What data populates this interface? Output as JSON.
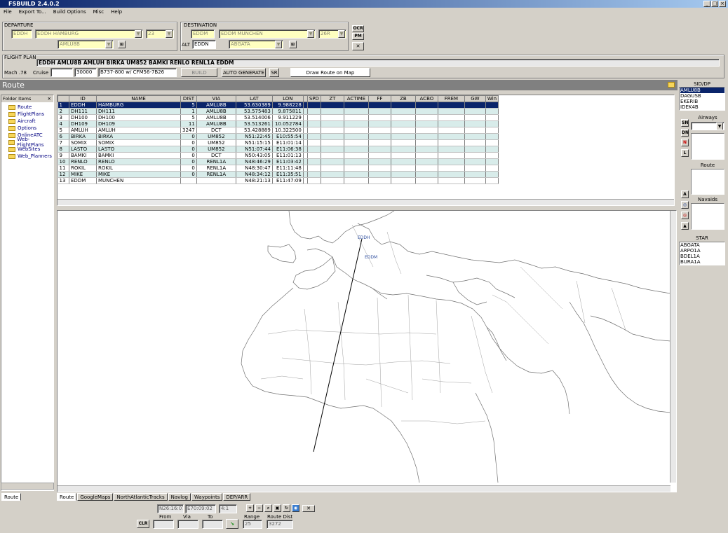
{
  "window": {
    "title": "FSBUILD 2.4.0.2"
  },
  "menu": [
    "File",
    "Export To...",
    "Build Options",
    "Misc",
    "Help"
  ],
  "departure": {
    "group_label": "DEPARTURE",
    "icao": "EDDH",
    "airport": "EDDH HAMBURG",
    "runway": "23",
    "sid": "AMLU8B"
  },
  "destination": {
    "group_label": "DESTINATION",
    "icao": "EDDM",
    "airport": "EDDM MUNCHEN",
    "runway": "26R",
    "alt_label": "ALT",
    "alt_icao": "EDDN",
    "star": "ABGATA"
  },
  "side_buttons": {
    "ocr": "OCR",
    "pm": "PM"
  },
  "flight_plan": {
    "group_label": "FLIGHT PLAN",
    "route": "EDDH AMLU8B AMLUH BIRKA UM852 BAMKI RENLO RENL1A EDDM",
    "mach_label": "Mach .78",
    "cruise_label": "Cruise",
    "cruise_value": "30000",
    "aircraft": "B737-800 w/ CFM56-7B26",
    "build_label": "BUILD",
    "autogen_label": "AUTO GENERATE",
    "sr_label": "SR",
    "draw_label": "Draw Route on Map"
  },
  "section_title": "Route",
  "tree": {
    "header": "Folder Items",
    "items": [
      "Route",
      "FlightPlans",
      "Aircraft",
      "Options",
      "OnlineATC",
      "Web-FlightPlans",
      "WebSites",
      "Web_Planners"
    ],
    "tab_label": "Route"
  },
  "route_table": {
    "columns": [
      "ID",
      "NAME",
      "DIST",
      "VIA",
      "LAT",
      "LON",
      "SPD",
      "ZT",
      "ACTIME",
      "FF",
      "ZB",
      "ACBO",
      "FREM",
      "GW",
      "Win"
    ],
    "rows": [
      [
        "1",
        "EDDH",
        "HAMBURG",
        "5",
        "AMLU8B",
        "53.630389",
        "9.988228"
      ],
      [
        "2",
        "DH111",
        "DH111",
        "1",
        "AMLU8B",
        "53.575483",
        "9.875811"
      ],
      [
        "3",
        "DH100",
        "DH100",
        "5",
        "AMLU8B",
        "53.514006",
        "9.911229"
      ],
      [
        "4",
        "DH109",
        "DH109",
        "11",
        "AMLU8B",
        "53.513261",
        "10.052784"
      ],
      [
        "5",
        "AMLUH",
        "AMLUH",
        "3247",
        "DCT",
        "53.428889",
        "10.322500"
      ],
      [
        "6",
        "BIRKA",
        "BIRKA",
        "0",
        "UM852",
        "N51:22:45",
        "E10:55:54"
      ],
      [
        "7",
        "SOMIX",
        "SOMIX",
        "0",
        "UM852",
        "N51:15:15",
        "E11:01:14"
      ],
      [
        "8",
        "LASTO",
        "LASTO",
        "0",
        "UM852",
        "N51:07:44",
        "E11:06:38"
      ],
      [
        "9",
        "BAMKI",
        "BAMKI",
        "0",
        "DCT",
        "N50:43:05",
        "E11:01:13"
      ],
      [
        "10",
        "RENLO",
        "RENLO",
        "0",
        "RENL1A",
        "N48:46:29",
        "E11:03:42"
      ],
      [
        "11",
        "ROKIL",
        "ROKIL",
        "0",
        "RENL1A",
        "N48:30:47",
        "E11:11:48"
      ],
      [
        "12",
        "MIKE",
        "MIKE",
        "0",
        "RENL1A",
        "N48:34:12",
        "E11:35:51"
      ],
      [
        "13",
        "EDDM",
        "MUNCHEN",
        "",
        "",
        "N48:21:13",
        "E11:47:09"
      ]
    ]
  },
  "map": {
    "label_eddh": "EDDH",
    "label_eddm": "EDDM"
  },
  "bottom_tabs": [
    "Route",
    "GoogleMaps",
    "NorthAtlanticTracks",
    "Navlog",
    "Waypoints",
    "DEP/ARR"
  ],
  "status": {
    "coords_lat": "N26:16:07",
    "coords_lon": "E70:09:02",
    "zoom": "4:1",
    "clr_label": "CLR",
    "from_label": "From",
    "via_label": "Via",
    "to_label": "To",
    "range_label": "Range",
    "range_value": "25",
    "route_dist_label": "Route Dist",
    "route_dist_value": "3272"
  },
  "right_panel": {
    "sid_title": "SID/DP",
    "sid_items": [
      "AMLU8B",
      "DAGUSB",
      "EKERIB",
      "IDEK4B"
    ],
    "airway_title": "Airways",
    "route_title": "Route",
    "navaids_title": "Navaids",
    "star_title": "STAR",
    "star_items": [
      "ABGATA",
      "ARPO1A",
      "BDEL1A",
      "BURA1A"
    ],
    "buttons": [
      "SN",
      "DN",
      "N",
      "L"
    ]
  },
  "colors": {
    "selected_row": "#0a246a",
    "alt_row": "#d8ecea",
    "route_line": "#000000"
  }
}
